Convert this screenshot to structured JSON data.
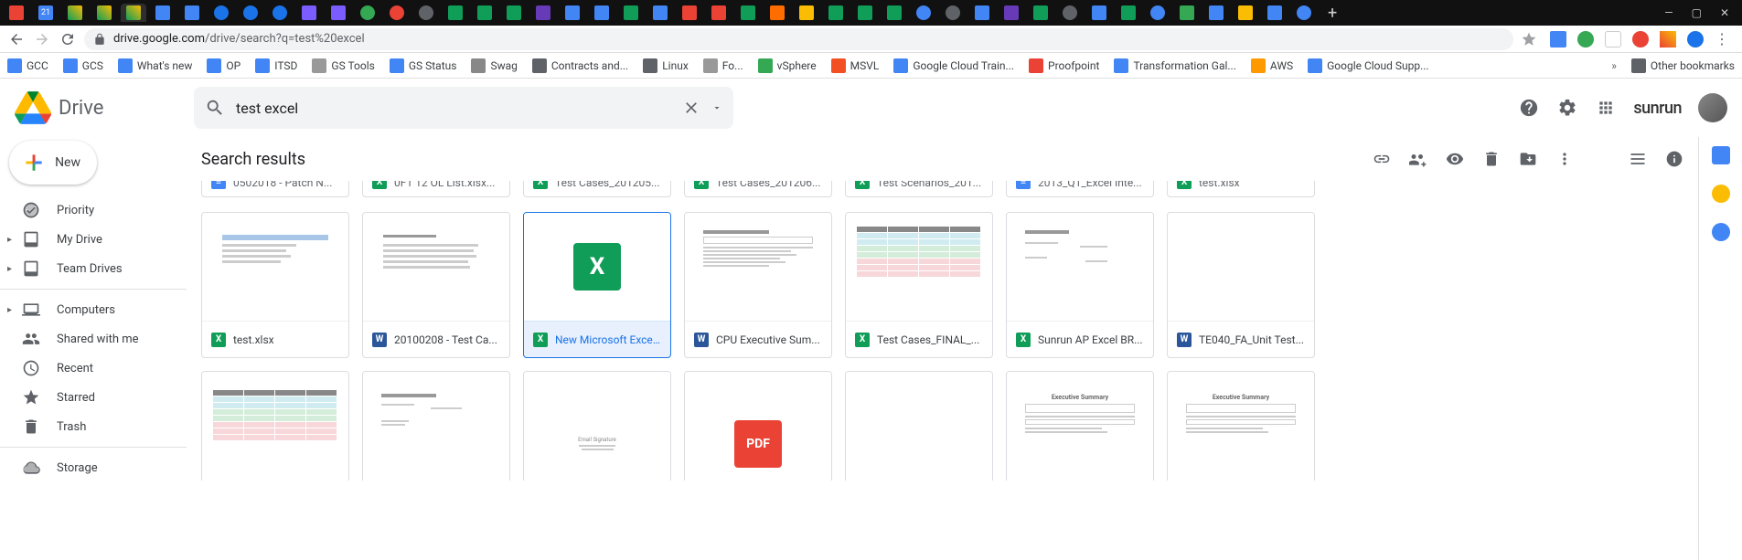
{
  "browser": {
    "url_host": "drive.google.com",
    "url_path": "/drive/search?q=test%20excel",
    "other_bookmarks_label": "Other bookmarks",
    "bookmarks": [
      {
        "label": "GCC",
        "color": "#4285f4"
      },
      {
        "label": "GCS",
        "color": "#4285f4"
      },
      {
        "label": "What's new",
        "color": "#4285f4"
      },
      {
        "label": "OP",
        "color": "#4285f4"
      },
      {
        "label": "ITSD",
        "color": "#4285f4"
      },
      {
        "label": "GS Tools",
        "color": "#999"
      },
      {
        "label": "GS Status",
        "color": "#4285f4"
      },
      {
        "label": "Swag",
        "color": "#888"
      },
      {
        "label": "Contracts and...",
        "color": "#5f6368"
      },
      {
        "label": "Linux",
        "color": "#5f6368"
      },
      {
        "label": "Fo...",
        "color": "#999"
      },
      {
        "label": "vSphere",
        "color": "#34a853"
      },
      {
        "label": "MSVL",
        "color": "#f25022"
      },
      {
        "label": "Google Cloud Train...",
        "color": "#4285f4"
      },
      {
        "label": "Proofpoint",
        "color": "#ea4335"
      },
      {
        "label": "Transformation Gal...",
        "color": "#4285f4"
      },
      {
        "label": "AWS",
        "color": "#ff9900"
      },
      {
        "label": "Google Cloud Supp...",
        "color": "#4285f4"
      }
    ]
  },
  "drive": {
    "app_name": "Drive",
    "search_value": "test excel",
    "brand": "sunrun",
    "new_button": "New",
    "results_title": "Search results",
    "sidebar": [
      {
        "label": "Priority",
        "icon": "check-circle"
      },
      {
        "label": "My Drive",
        "icon": "drive",
        "expandable": true
      },
      {
        "label": "Team Drives",
        "icon": "team-drive",
        "expandable": true
      },
      {
        "label": "Computers",
        "icon": "computer",
        "expandable": true
      },
      {
        "label": "Shared with me",
        "icon": "people"
      },
      {
        "label": "Recent",
        "icon": "clock"
      },
      {
        "label": "Starred",
        "icon": "star"
      },
      {
        "label": "Trash",
        "icon": "trash"
      },
      {
        "label": "Storage",
        "icon": "cloud"
      }
    ],
    "partial_row": [
      {
        "name": "0502018 - Patch N...",
        "type": "docs"
      },
      {
        "name": "0F1 12 OL List.xlsx...",
        "type": "sheets"
      },
      {
        "name": "Test Cases_201205...",
        "type": "sheets"
      },
      {
        "name": "Test Cases_201206...",
        "type": "sheets"
      },
      {
        "name": "Test Scenarios_201...",
        "type": "sheets"
      },
      {
        "name": "2013_Q1_Excel Inte...",
        "type": "docs"
      },
      {
        "name": "test.xlsx",
        "type": "sheets"
      }
    ],
    "row1": [
      {
        "name": "test.xlsx",
        "type": "sheets",
        "preview": "doc-lines-header"
      },
      {
        "name": "20100208 - Test Ca...",
        "type": "word",
        "preview": "doc-text"
      },
      {
        "name": "New Microsoft Exce...",
        "type": "sheets",
        "preview": "excel-icon",
        "selected": true
      },
      {
        "name": "CPU Executive Sum...",
        "type": "word",
        "preview": "form"
      },
      {
        "name": "Test Cases_FINAL_...",
        "type": "sheets",
        "preview": "color-table"
      },
      {
        "name": "Sunrun AP Excel BR...",
        "type": "sheets",
        "preview": "sparse-table"
      },
      {
        "name": "TE040_FA_Unit Test...",
        "type": "word",
        "preview": "blank"
      }
    ],
    "row2": [
      {
        "name": "",
        "type": "",
        "preview": "color-table"
      },
      {
        "name": "",
        "type": "",
        "preview": "sparse-text"
      },
      {
        "name": "",
        "type": "",
        "preview": "centered-text"
      },
      {
        "name": "",
        "type": "",
        "preview": "pdf-icon"
      },
      {
        "name": "",
        "type": "",
        "preview": "blank"
      },
      {
        "name": "",
        "type": "",
        "preview": "exec-summary",
        "title": "Executive Summary"
      },
      {
        "name": "",
        "type": "",
        "preview": "exec-summary",
        "title": "Executive Summary"
      }
    ]
  }
}
